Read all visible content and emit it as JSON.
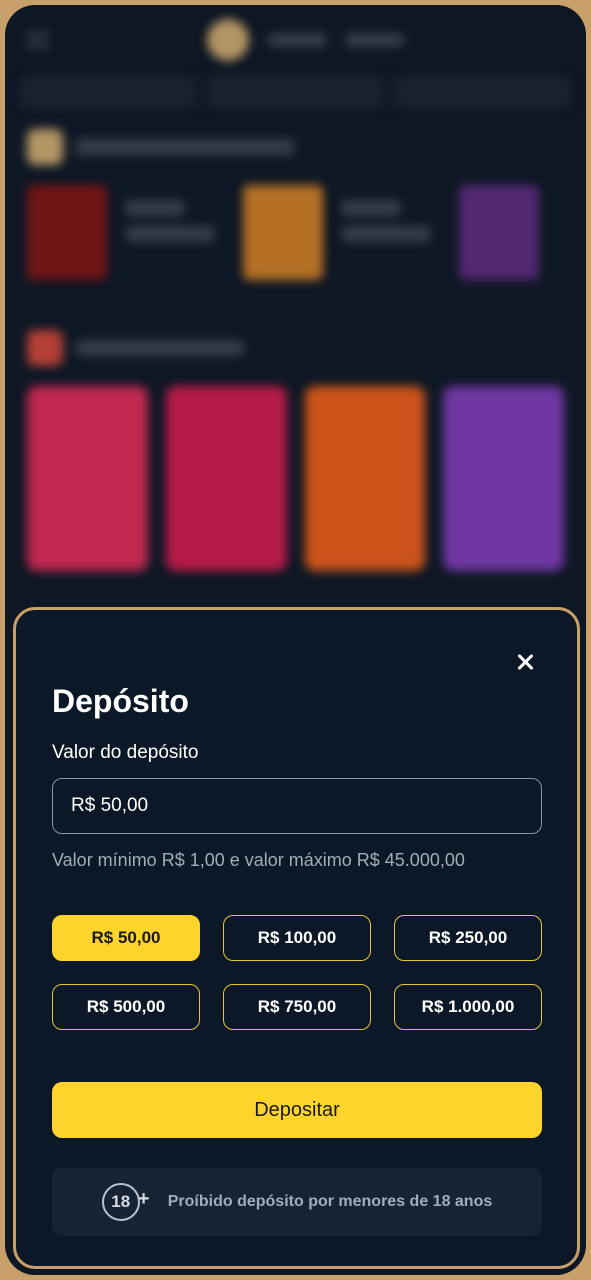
{
  "modal": {
    "title": "Depósito",
    "field_label": "Valor do depósito",
    "input_value": "R$ 50,00",
    "range_note": "Valor mínimo R$ 1,00 e valor máximo R$ 45.000,00",
    "amounts": [
      {
        "label": "R$ 50,00",
        "selected": true
      },
      {
        "label": "R$ 100,00",
        "selected": false
      },
      {
        "label": "R$ 250,00",
        "selected": false
      },
      {
        "label": "R$ 500,00",
        "selected": false
      },
      {
        "label": "R$ 750,00",
        "selected": false
      },
      {
        "label": "R$ 1.000,00",
        "selected": false
      }
    ],
    "deposit_label": "Depositar",
    "age_badge": "18",
    "age_plus": "+",
    "age_notice": "Proíbido depósito por menores de 18 anos"
  },
  "colors": {
    "accent": "#fdd42c",
    "modal_bg": "#0c1827",
    "frame": "#c9a06a"
  }
}
